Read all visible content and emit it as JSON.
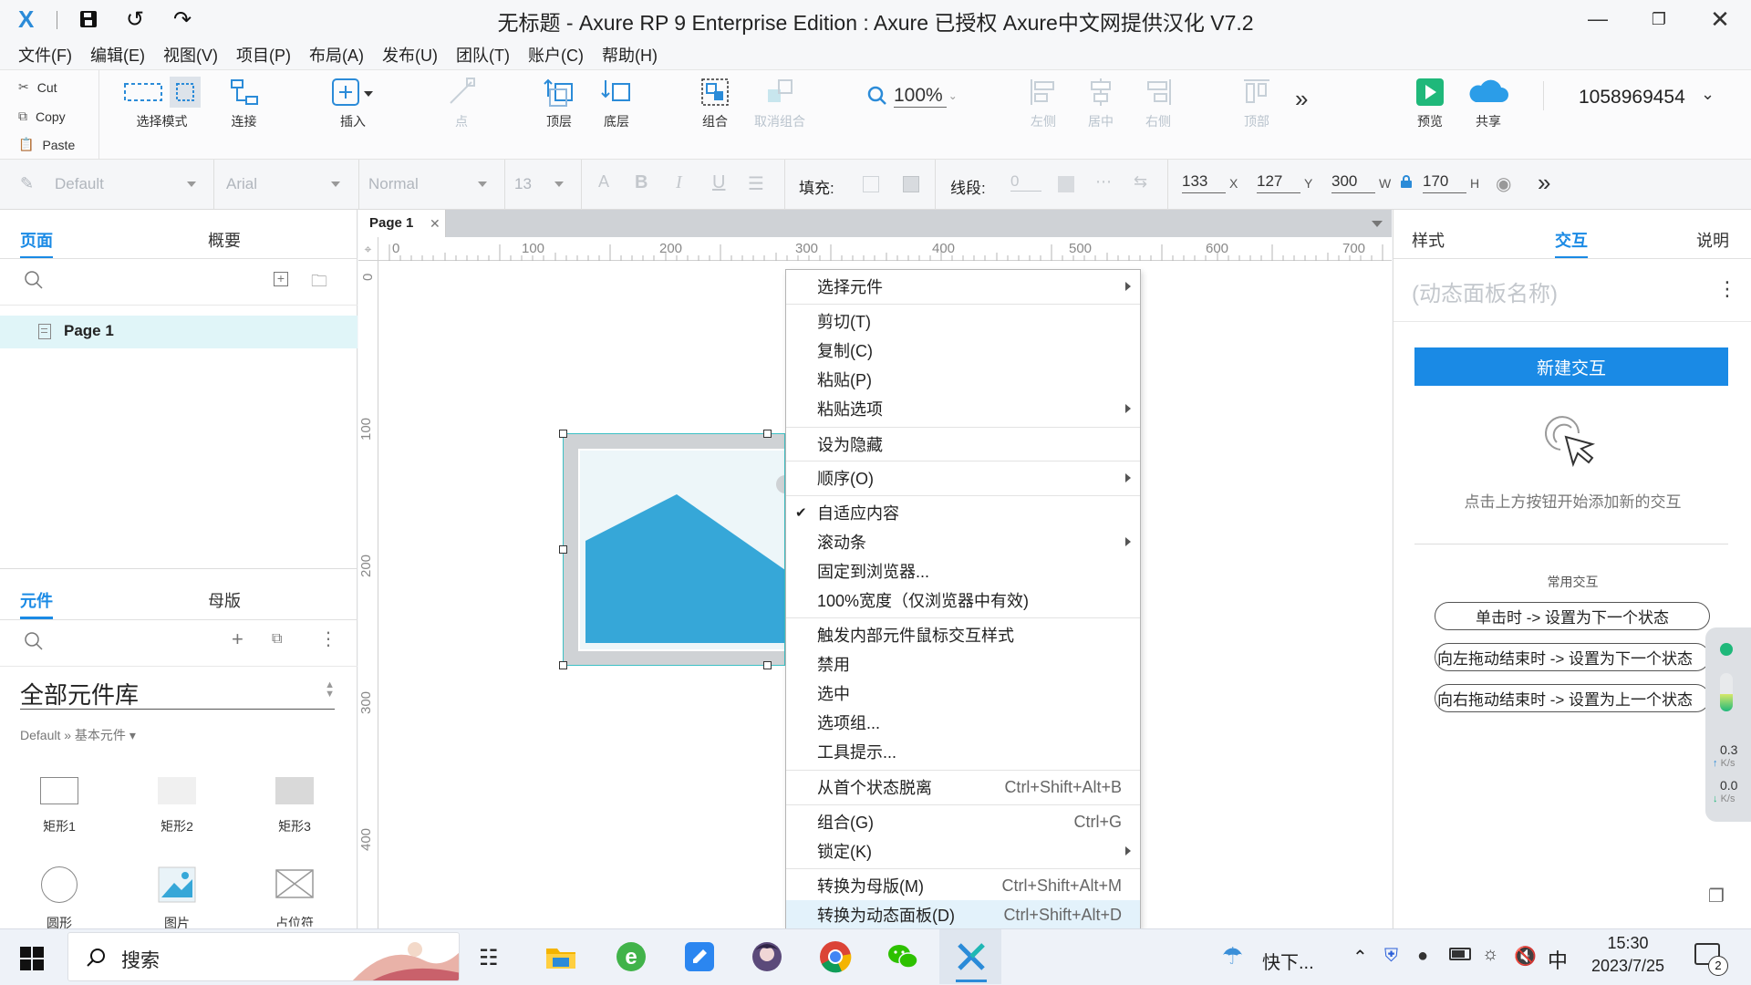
{
  "titlebar": {
    "title": "无标题 - Axure RP 9 Enterprise Edition : Axure 已授权     Axure中文网提供汉化 V7.2",
    "app_logo": "X",
    "icons": [
      "save-icon",
      "undo-icon",
      "redo-icon"
    ],
    "window_controls": [
      "minimize-icon",
      "restore-icon",
      "close-icon"
    ]
  },
  "menubar": [
    "文件(F)",
    "编辑(E)",
    "视图(V)",
    "项目(P)",
    "布局(A)",
    "发布(U)",
    "团队(T)",
    "账户(C)",
    "帮助(H)"
  ],
  "toolbar": {
    "clipboard": [
      "Cut",
      "Copy",
      "Paste"
    ],
    "select_mode": "选择模式",
    "connect": "连接",
    "insert": "插入",
    "point": "点",
    "top_layer": "顶层",
    "bottom_layer": "底层",
    "group": "组合",
    "ungroup": "取消组合",
    "zoom": "100%",
    "align_left": "左侧",
    "align_center": "居中",
    "align_right": "右侧",
    "align_top": "顶部",
    "preview": "预览",
    "share": "共享",
    "account": "1058969454"
  },
  "formatbar": {
    "style": "Default",
    "font": "Arial",
    "weight": "Normal",
    "size": "13",
    "fill_label": "填充:",
    "stroke_label": "线段:",
    "stroke_value": "0",
    "x": "133",
    "x_label": "X",
    "y": "127",
    "y_label": "Y",
    "w": "300",
    "w_label": "W",
    "h": "170",
    "h_label": "H"
  },
  "leftpanel": {
    "tabs": [
      "页面",
      "概要"
    ],
    "page_item": "Page 1",
    "lib_tabs": [
      "元件",
      "母版"
    ],
    "library_name": "全部元件库",
    "library_path": "Default » 基本元件 ▾",
    "widgets": [
      "矩形1",
      "矩形2",
      "矩形3",
      "圆形",
      "图片",
      "占位符"
    ]
  },
  "canvas": {
    "page_tab": "Page 1",
    "ruler_h": [
      "0",
      "100",
      "200",
      "300",
      "400",
      "500",
      "600",
      "700"
    ],
    "ruler_v": [
      "0",
      "100",
      "200",
      "300",
      "400"
    ]
  },
  "context_menu": {
    "items": [
      {
        "label": "选择元件",
        "shortcut": "",
        "submenu": true
      },
      {
        "label": "剪切(T)",
        "shortcut": "",
        "submenu": false
      },
      {
        "label": "复制(C)",
        "shortcut": "",
        "submenu": false
      },
      {
        "label": "粘贴(P)",
        "shortcut": "",
        "submenu": false
      },
      {
        "label": "粘贴选项",
        "shortcut": "",
        "submenu": true
      },
      {
        "label": "设为隐藏",
        "shortcut": "",
        "submenu": false
      },
      {
        "label": "顺序(O)",
        "shortcut": "",
        "submenu": true
      },
      {
        "label": "自适应内容",
        "shortcut": "",
        "submenu": false,
        "checked": true
      },
      {
        "label": "滚动条",
        "shortcut": "",
        "submenu": true
      },
      {
        "label": "固定到浏览器...",
        "shortcut": "",
        "submenu": false
      },
      {
        "label": "100%宽度（仅浏览器中有效)",
        "shortcut": "",
        "submenu": false
      },
      {
        "label": "触发内部元件鼠标交互样式",
        "shortcut": "",
        "submenu": false
      },
      {
        "label": "禁用",
        "shortcut": "",
        "submenu": false
      },
      {
        "label": "选中",
        "shortcut": "",
        "submenu": false
      },
      {
        "label": "选项组...",
        "shortcut": "",
        "submenu": false
      },
      {
        "label": "工具提示...",
        "shortcut": "",
        "submenu": false
      },
      {
        "label": "从首个状态脱离",
        "shortcut": "Ctrl+Shift+Alt+B",
        "submenu": false
      },
      {
        "label": "组合(G)",
        "shortcut": "Ctrl+G",
        "submenu": false
      },
      {
        "label": "锁定(K)",
        "shortcut": "",
        "submenu": true
      },
      {
        "label": "转换为母版(M)",
        "shortcut": "Ctrl+Shift+Alt+M",
        "submenu": false
      },
      {
        "label": "转换为动态面板(D)",
        "shortcut": "Ctrl+Shift+Alt+D",
        "submenu": false,
        "highlighted": true
      }
    ]
  },
  "rightpanel": {
    "tabs": [
      "样式",
      "交互",
      "说明"
    ],
    "panel_name_placeholder": "(动态面板名称)",
    "new_interaction": "新建交互",
    "hint": "点击上方按钮开始添加新的交互",
    "common_title": "常用交互",
    "common": [
      "单击时 -> 设置为下一个状态",
      "向左拖动结束时 -> 设置为下一个状态",
      "向右拖动结束时 -> 设置为上一个状态"
    ]
  },
  "netmon": {
    "up": "0.3",
    "up_unit": "K/s",
    "down": "0.0",
    "down_unit": "K/s"
  },
  "taskbar": {
    "search": "搜索",
    "weather_text": "快下...",
    "ime": "中",
    "time": "15:30",
    "date": "2023/7/25",
    "notif_count": "2"
  },
  "colors": {
    "accent": "#1a8ae5",
    "selection": "#3cc0c5",
    "image_blue": "#36a7d8",
    "menu_highlight": "#e3f2fb",
    "page_highlight": "#e0f5f8"
  }
}
